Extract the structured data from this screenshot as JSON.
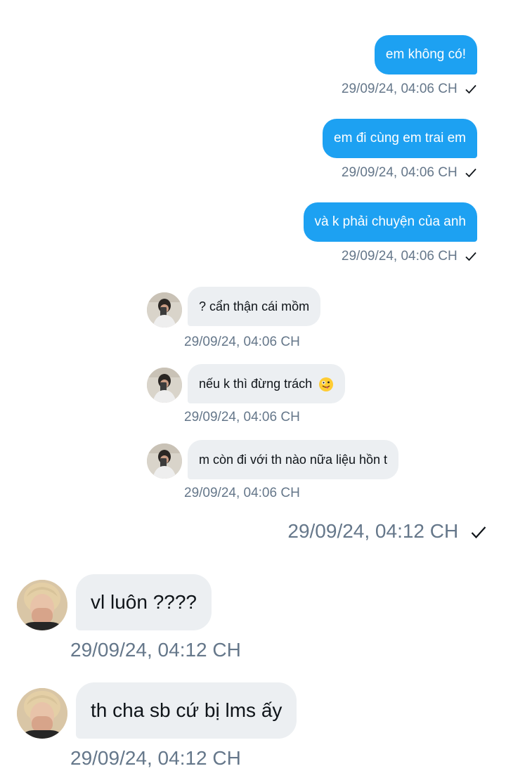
{
  "outgoing": [
    {
      "text": "em không có!",
      "time": "29/09/24, 04:06 CH"
    },
    {
      "text": "em đi cùng em trai em",
      "time": "29/09/24, 04:06 CH"
    },
    {
      "text": "và k phải chuyện của anh",
      "time": "29/09/24, 04:06 CH"
    }
  ],
  "incoming_small": [
    {
      "text": "? cẩn thận cái mồm",
      "time": "29/09/24, 04:06 CH"
    },
    {
      "text": "nếu k thì đừng trách",
      "time": "29/09/24, 04:06 CH"
    },
    {
      "text": "m còn đi với th nào nữa liệu hồn t",
      "time": "29/09/24, 04:06 CH"
    }
  ],
  "shared_time": "29/09/24, 04:12 CH",
  "incoming_large": [
    {
      "text": "vl luôn ????",
      "time": "29/09/24, 04:12 CH"
    },
    {
      "text": "th cha sb cứ bị lms ấy",
      "time": "29/09/24, 04:12 CH"
    }
  ],
  "icons": {
    "read_receipt": "check-icon",
    "emoji": "zany-face-emoji"
  },
  "colors": {
    "outgoing_bubble": "#1da1f2",
    "incoming_bubble": "#eceff2",
    "timestamp": "#65778a"
  }
}
